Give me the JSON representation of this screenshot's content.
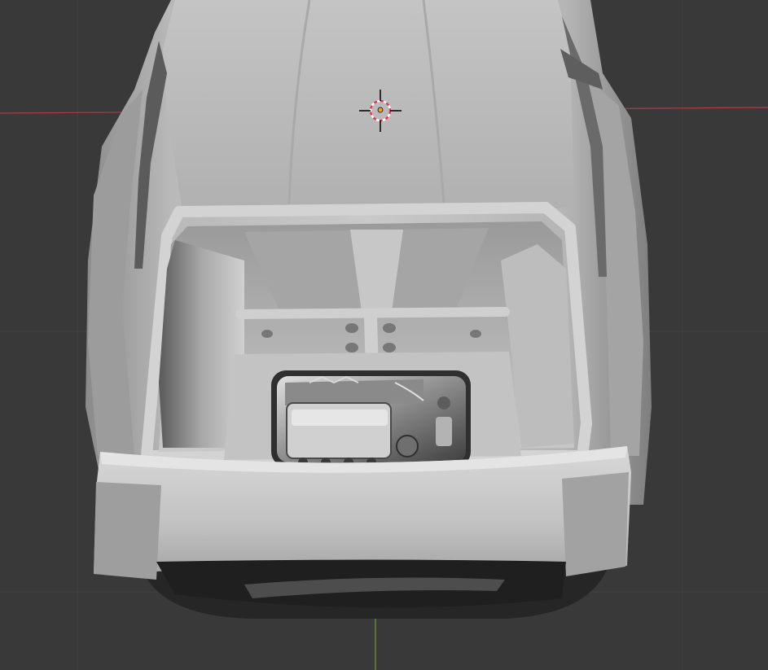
{
  "viewport": {
    "background_color": "#393939",
    "grid_color": "#434343",
    "x_axis_color": "#a83d4a",
    "y_axis_color": "#6e9b2a",
    "cursor_icon": "3d-cursor-icon",
    "object_origin_icon": "origin-dot-icon",
    "model_name_icon": "car-body-mesh"
  }
}
